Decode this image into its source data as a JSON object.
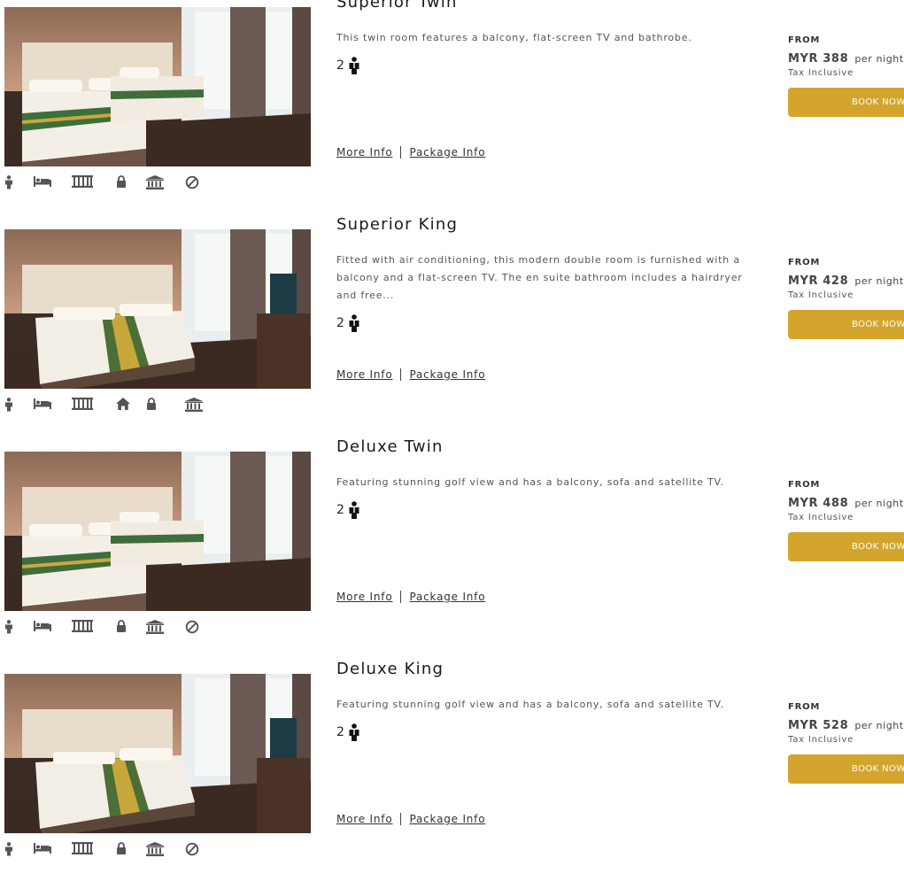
{
  "rooms": [
    {
      "name": "Superior Twin",
      "description": "This twin room features a balcony, flat-screen TV and bathrobe.",
      "guests": "2",
      "more_info": "More Info",
      "package_info": "Package Info",
      "from_label": "FROM",
      "price": "MYR 388",
      "per_night": "per night",
      "tax": "Tax Inclusive",
      "book_label": "BOOK NOW",
      "bed_type": "twin",
      "amenities": [
        "person-icon",
        "bed-icon",
        "balcony-icon",
        "lock-icon",
        "bank-icon",
        "no-smoking-icon"
      ]
    },
    {
      "name": "Superior King",
      "description": "Fitted with air conditioning, this modern double room is furnished with a balcony and a flat-screen TV. The en suite bathroom includes a hairdryer and free...",
      "guests": "2",
      "more_info": "More Info",
      "package_info": "Package Info",
      "from_label": "FROM",
      "price": "MYR 428",
      "per_night": "per night",
      "tax": "Tax Inclusive",
      "book_label": "BOOK NOW",
      "bed_type": "king",
      "amenities": [
        "person-icon",
        "bed-icon",
        "balcony-icon",
        "home-icon",
        "lock-icon",
        "bank-icon"
      ]
    },
    {
      "name": "Deluxe Twin",
      "description": "Featuring stunning golf view and has a balcony, sofa and satellite TV.",
      "guests": "2",
      "more_info": "More Info",
      "package_info": "Package Info",
      "from_label": "FROM",
      "price": "MYR 488",
      "per_night": "per night",
      "tax": "Tax Inclusive",
      "book_label": "BOOK NOW",
      "bed_type": "twin",
      "amenities": [
        "person-icon",
        "bed-icon",
        "balcony-icon",
        "lock-icon",
        "bank-icon",
        "no-smoking-icon"
      ]
    },
    {
      "name": "Deluxe King",
      "description": "Featuring stunning golf view and has a balcony, sofa and satellite TV.",
      "guests": "2",
      "more_info": "More Info",
      "package_info": "Package Info",
      "from_label": "FROM",
      "price": "MYR 528",
      "per_night": "per night",
      "tax": "Tax Inclusive",
      "book_label": "BOOK NOW",
      "bed_type": "king",
      "amenities": [
        "person-icon",
        "bed-icon",
        "balcony-icon",
        "lock-icon",
        "bank-icon",
        "no-smoking-icon"
      ]
    }
  ],
  "colors": {
    "accent": "#d4a52c",
    "icon": "#555555",
    "text": "#333333"
  }
}
